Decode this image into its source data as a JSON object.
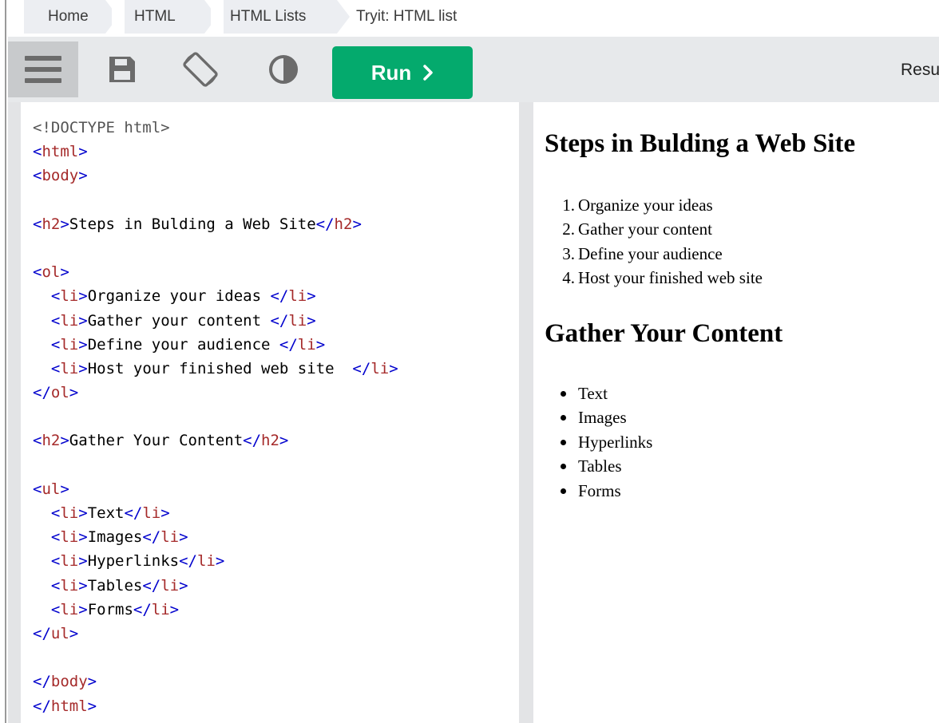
{
  "breadcrumb": [
    "Home",
    "HTML",
    "HTML Lists",
    "Tryit: HTML list"
  ],
  "toolbar": {
    "run_label": "Run",
    "result_label": "Result"
  },
  "code_lines": [
    [
      {
        "t": "doctype",
        "v": "<!DOCTYPE html>"
      }
    ],
    [
      {
        "t": "br",
        "v": "<"
      },
      {
        "t": "tag",
        "v": "html"
      },
      {
        "t": "br",
        "v": ">"
      }
    ],
    [
      {
        "t": "br",
        "v": "<"
      },
      {
        "t": "tag",
        "v": "body"
      },
      {
        "t": "br",
        "v": ">"
      }
    ],
    [],
    [
      {
        "t": "br",
        "v": "<"
      },
      {
        "t": "tag",
        "v": "h2"
      },
      {
        "t": "br",
        "v": ">"
      },
      {
        "t": "text",
        "v": "Steps in Bulding a Web Site"
      },
      {
        "t": "br",
        "v": "</"
      },
      {
        "t": "tag",
        "v": "h2"
      },
      {
        "t": "br",
        "v": ">"
      }
    ],
    [],
    [
      {
        "t": "br",
        "v": "<"
      },
      {
        "t": "tag",
        "v": "ol"
      },
      {
        "t": "br",
        "v": ">"
      }
    ],
    [
      {
        "t": "text",
        "v": "  "
      },
      {
        "t": "br",
        "v": "<"
      },
      {
        "t": "tag",
        "v": "li"
      },
      {
        "t": "br",
        "v": ">"
      },
      {
        "t": "text",
        "v": "Organize your ideas "
      },
      {
        "t": "br",
        "v": "</"
      },
      {
        "t": "tag",
        "v": "li"
      },
      {
        "t": "br",
        "v": ">"
      }
    ],
    [
      {
        "t": "text",
        "v": "  "
      },
      {
        "t": "br",
        "v": "<"
      },
      {
        "t": "tag",
        "v": "li"
      },
      {
        "t": "br",
        "v": ">"
      },
      {
        "t": "text",
        "v": "Gather your content "
      },
      {
        "t": "br",
        "v": "</"
      },
      {
        "t": "tag",
        "v": "li"
      },
      {
        "t": "br",
        "v": ">"
      }
    ],
    [
      {
        "t": "text",
        "v": "  "
      },
      {
        "t": "br",
        "v": "<"
      },
      {
        "t": "tag",
        "v": "li"
      },
      {
        "t": "br",
        "v": ">"
      },
      {
        "t": "text",
        "v": "Define your audience "
      },
      {
        "t": "br",
        "v": "</"
      },
      {
        "t": "tag",
        "v": "li"
      },
      {
        "t": "br",
        "v": ">"
      }
    ],
    [
      {
        "t": "text",
        "v": "  "
      },
      {
        "t": "br",
        "v": "<"
      },
      {
        "t": "tag",
        "v": "li"
      },
      {
        "t": "br",
        "v": ">"
      },
      {
        "t": "text",
        "v": "Host your finished web site  "
      },
      {
        "t": "br",
        "v": "</"
      },
      {
        "t": "tag",
        "v": "li"
      },
      {
        "t": "br",
        "v": ">"
      }
    ],
    [
      {
        "t": "br",
        "v": "</"
      },
      {
        "t": "tag",
        "v": "ol"
      },
      {
        "t": "br",
        "v": ">"
      }
    ],
    [],
    [
      {
        "t": "br",
        "v": "<"
      },
      {
        "t": "tag",
        "v": "h2"
      },
      {
        "t": "br",
        "v": ">"
      },
      {
        "t": "text",
        "v": "Gather Your Content"
      },
      {
        "t": "br",
        "v": "</"
      },
      {
        "t": "tag",
        "v": "h2"
      },
      {
        "t": "br",
        "v": ">"
      }
    ],
    [],
    [
      {
        "t": "br",
        "v": "<"
      },
      {
        "t": "tag",
        "v": "ul"
      },
      {
        "t": "br",
        "v": ">"
      }
    ],
    [
      {
        "t": "text",
        "v": "  "
      },
      {
        "t": "br",
        "v": "<"
      },
      {
        "t": "tag",
        "v": "li"
      },
      {
        "t": "br",
        "v": ">"
      },
      {
        "t": "text",
        "v": "Text"
      },
      {
        "t": "br",
        "v": "</"
      },
      {
        "t": "tag",
        "v": "li"
      },
      {
        "t": "br",
        "v": ">"
      }
    ],
    [
      {
        "t": "text",
        "v": "  "
      },
      {
        "t": "br",
        "v": "<"
      },
      {
        "t": "tag",
        "v": "li"
      },
      {
        "t": "br",
        "v": ">"
      },
      {
        "t": "text",
        "v": "Images"
      },
      {
        "t": "br",
        "v": "</"
      },
      {
        "t": "tag",
        "v": "li"
      },
      {
        "t": "br",
        "v": ">"
      }
    ],
    [
      {
        "t": "text",
        "v": "  "
      },
      {
        "t": "br",
        "v": "<"
      },
      {
        "t": "tag",
        "v": "li"
      },
      {
        "t": "br",
        "v": ">"
      },
      {
        "t": "text",
        "v": "Hyperlinks"
      },
      {
        "t": "br",
        "v": "</"
      },
      {
        "t": "tag",
        "v": "li"
      },
      {
        "t": "br",
        "v": ">"
      }
    ],
    [
      {
        "t": "text",
        "v": "  "
      },
      {
        "t": "br",
        "v": "<"
      },
      {
        "t": "tag",
        "v": "li"
      },
      {
        "t": "br",
        "v": ">"
      },
      {
        "t": "text",
        "v": "Tables"
      },
      {
        "t": "br",
        "v": "</"
      },
      {
        "t": "tag",
        "v": "li"
      },
      {
        "t": "br",
        "v": ">"
      }
    ],
    [
      {
        "t": "text",
        "v": "  "
      },
      {
        "t": "br",
        "v": "<"
      },
      {
        "t": "tag",
        "v": "li"
      },
      {
        "t": "br",
        "v": ">"
      },
      {
        "t": "text",
        "v": "Forms"
      },
      {
        "t": "br",
        "v": "</"
      },
      {
        "t": "tag",
        "v": "li"
      },
      {
        "t": "br",
        "v": ">"
      }
    ],
    [
      {
        "t": "br",
        "v": "</"
      },
      {
        "t": "tag",
        "v": "ul"
      },
      {
        "t": "br",
        "v": ">"
      }
    ],
    [],
    [
      {
        "t": "br",
        "v": "</"
      },
      {
        "t": "tag",
        "v": "body"
      },
      {
        "t": "br",
        "v": ">"
      }
    ],
    [
      {
        "t": "br",
        "v": "</"
      },
      {
        "t": "tag",
        "v": "html"
      },
      {
        "t": "br",
        "v": ">"
      }
    ]
  ],
  "result": {
    "heading1": "Steps in Bulding a Web Site",
    "ordered_items": [
      "Organize your ideas",
      "Gather your content",
      "Define your audience",
      "Host your finished web site"
    ],
    "heading2": "Gather Your Content",
    "unordered_items": [
      "Text",
      "Images",
      "Hyperlinks",
      "Tables",
      "Forms"
    ]
  },
  "colors": {
    "run_button": "#04aa6d",
    "toolbar": "#e7e9eb",
    "tag": "#a52a2a",
    "bracket": "#0000cd"
  }
}
